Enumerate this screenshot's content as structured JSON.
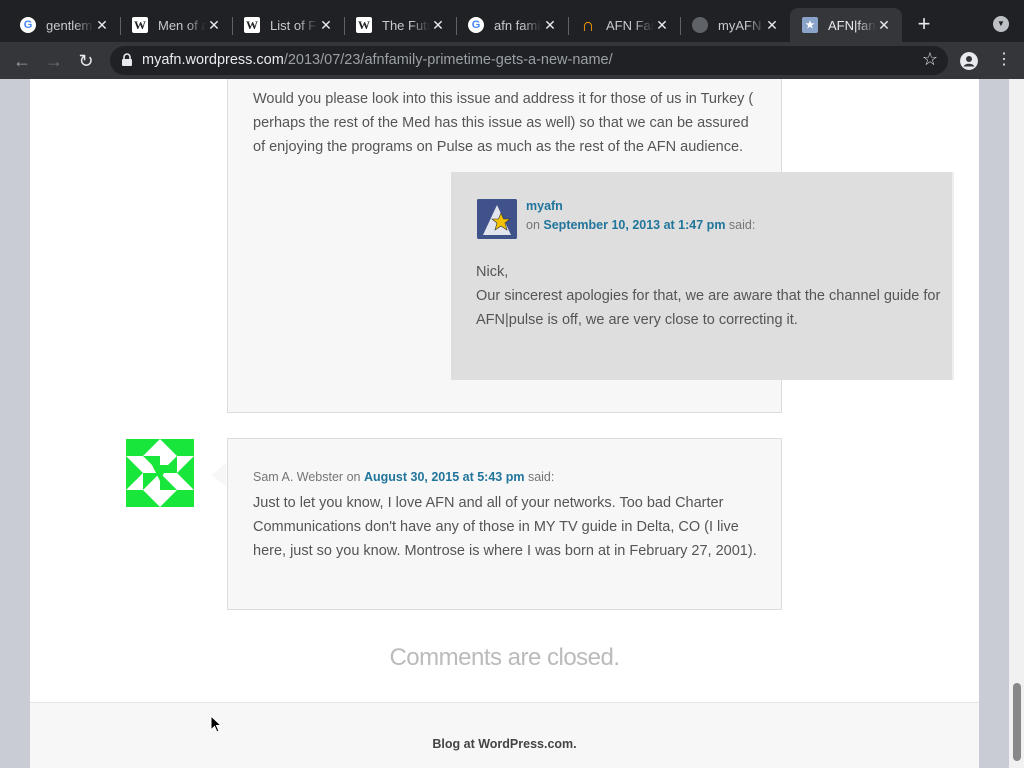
{
  "browser": {
    "tabs": [
      {
        "favicon": "google-icon",
        "title": "gentlem"
      },
      {
        "favicon": "wikipedia-icon",
        "title": "Men of a"
      },
      {
        "favicon": "wikipedia-icon",
        "title": "List of F"
      },
      {
        "favicon": "wikipedia-icon",
        "title": "The Futu"
      },
      {
        "favicon": "google-icon",
        "title": "afn famil"
      },
      {
        "favicon": "arch-logo-icon",
        "title": "AFN Fan"
      },
      {
        "favicon": "globe-icon",
        "title": "myAFN"
      },
      {
        "favicon": "afn-icon",
        "title": "AFN|fan",
        "active": true
      }
    ],
    "url_host": "myafn.wordpress.com",
    "url_path": "/2013/07/23/afnfamily-primetime-gets-a-new-name/"
  },
  "comments": {
    "first_tail_text": "Would you please look into this issue and address it for those of us in Turkey ( perhaps the rest of the Med has this issue as well) so that we can be assured of enjoying the programs on Pulse as much as the rest of the AFN audience.",
    "reply": {
      "author": "myafn",
      "on": "on",
      "date": "September 10, 2013 at 1:47 pm",
      "said": "said:",
      "greeting": "Nick,",
      "body": "Our sincerest apologies for that, we are aware that the channel guide for AFN|pulse is off, we are very close to correcting it."
    },
    "second": {
      "author": "Sam A. Webster",
      "on": "on",
      "date": "August 30, 2015 at 5:43 pm",
      "said": "said:",
      "body": "Just to let you know, I love AFN and all of your networks. Too bad Charter Communications don't have any of those in MY TV guide in Delta, CO (I live here, just so you know. Montrose is where I was born at in February 27, 2001)."
    },
    "closed_text": "Comments are closed."
  },
  "footer": {
    "text": "Blog at WordPress.com."
  }
}
